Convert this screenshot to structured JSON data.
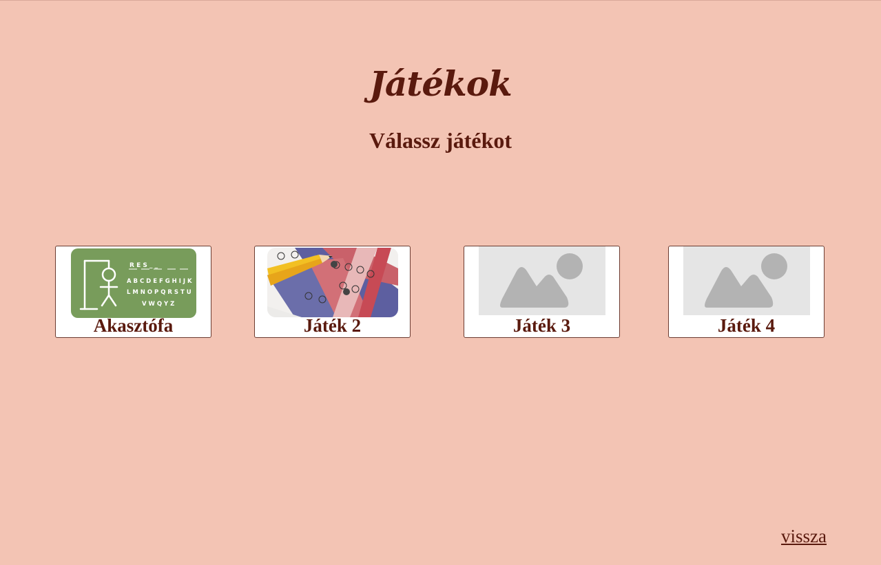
{
  "header": {
    "title": "Játékok",
    "subtitle": "Válassz játékot"
  },
  "games": [
    {
      "label": "Akasztófa",
      "thumbnail": "hangman-icon"
    },
    {
      "label": "Játék 2",
      "thumbnail": "english-test-image"
    },
    {
      "label": "Játék 3",
      "thumbnail": "image-placeholder-icon"
    },
    {
      "label": "Játék 4",
      "thumbnail": "image-placeholder-icon"
    }
  ],
  "hangman_thumb": {
    "word": "R E S _ _",
    "row1": "A B C D E F G H I J K",
    "row2": "L M N O P Q R S T U",
    "row3": "V W Q Y Z"
  },
  "footer": {
    "back_label": "vissza"
  },
  "colors": {
    "background": "#f3c4b4",
    "text": "#5a1a0e",
    "card": "#ffffff",
    "hangman_green": "#789c5b",
    "placeholder_bg": "#e5e5e5",
    "placeholder_shape": "#b3b3b3"
  }
}
